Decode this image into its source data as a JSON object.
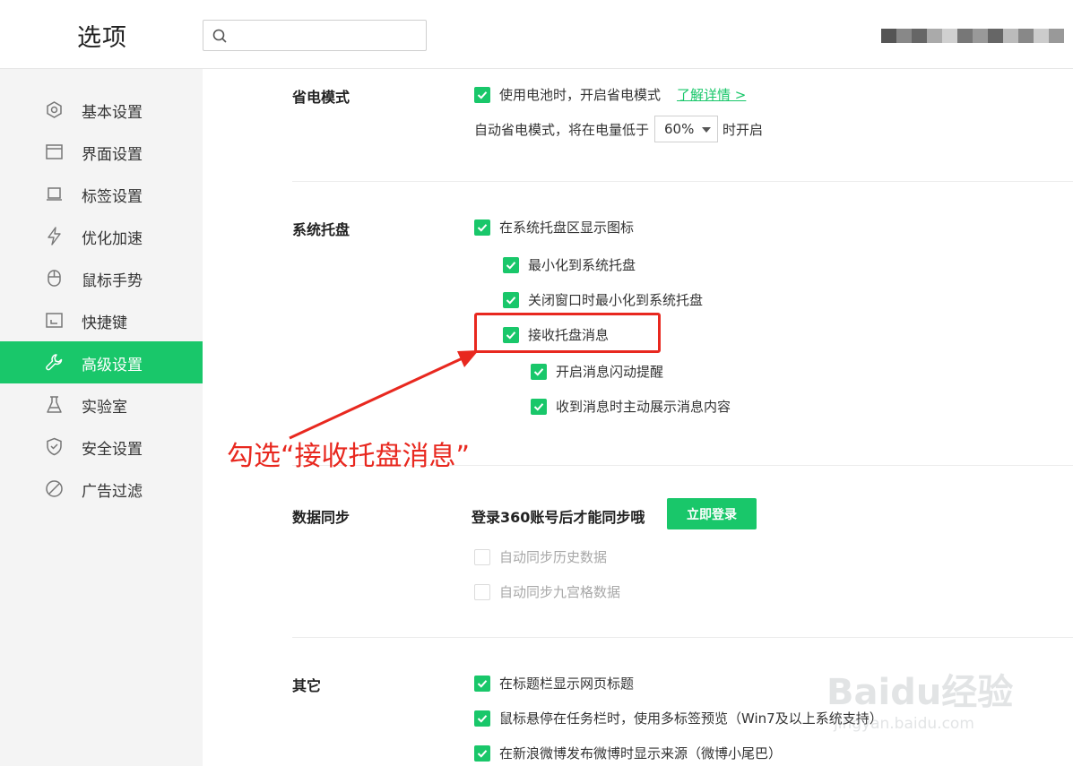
{
  "header": {
    "title": "选项",
    "search_placeholder": ""
  },
  "sidebar": {
    "items": [
      {
        "label": "基本设置",
        "icon": "hexagon-icon"
      },
      {
        "label": "界面设置",
        "icon": "window-icon"
      },
      {
        "label": "标签设置",
        "icon": "tab-icon"
      },
      {
        "label": "优化加速",
        "icon": "lightning-icon"
      },
      {
        "label": "鼠标手势",
        "icon": "mouse-icon"
      },
      {
        "label": "快捷键",
        "icon": "shortcut-icon"
      },
      {
        "label": "高级设置",
        "icon": "wrench-icon",
        "active": true
      },
      {
        "label": "实验室",
        "icon": "flask-icon"
      },
      {
        "label": "安全设置",
        "icon": "shield-icon"
      },
      {
        "label": "广告过滤",
        "icon": "block-icon"
      }
    ]
  },
  "power": {
    "title": "省电模式",
    "battery_option": "使用电池时，开启省电模式",
    "learn_more": "了解详情 >",
    "auto_prefix": "自动省电模式，将在电量低于",
    "threshold": "60%",
    "auto_suffix": "时开启"
  },
  "tray": {
    "title": "系统托盘",
    "show_icon": "在系统托盘区显示图标",
    "minimize": "最小化到系统托盘",
    "close_minimize": "关闭窗口时最小化到系统托盘",
    "receive_messages": "接收托盘消息",
    "flash_alert": "开启消息闪动提醒",
    "show_content": "收到消息时主动展示消息内容"
  },
  "sync": {
    "title": "数据同步",
    "prompt": "登录360账号后才能同步哦",
    "login_button": "立即登录",
    "history": "自动同步历史数据",
    "grid": "自动同步九宫格数据"
  },
  "other": {
    "title": "其它",
    "show_title": "在标题栏显示网页标题",
    "taskbar_preview": "鼠标悬停在任务栏时，使用多标签预览（Win7及以上系统支持）",
    "weibo_source": "在新浪微博发布微博时显示来源（微博小尾巴）"
  },
  "annotation": {
    "text": "勾选“接收托盘消息”",
    "color": "#e8281f"
  },
  "watermark": {
    "brand": "Baidu经验",
    "url": "jingyan.baidu.com"
  },
  "colors": {
    "accent": "#19c76a",
    "sidebar_bg": "#f4f4f4"
  }
}
